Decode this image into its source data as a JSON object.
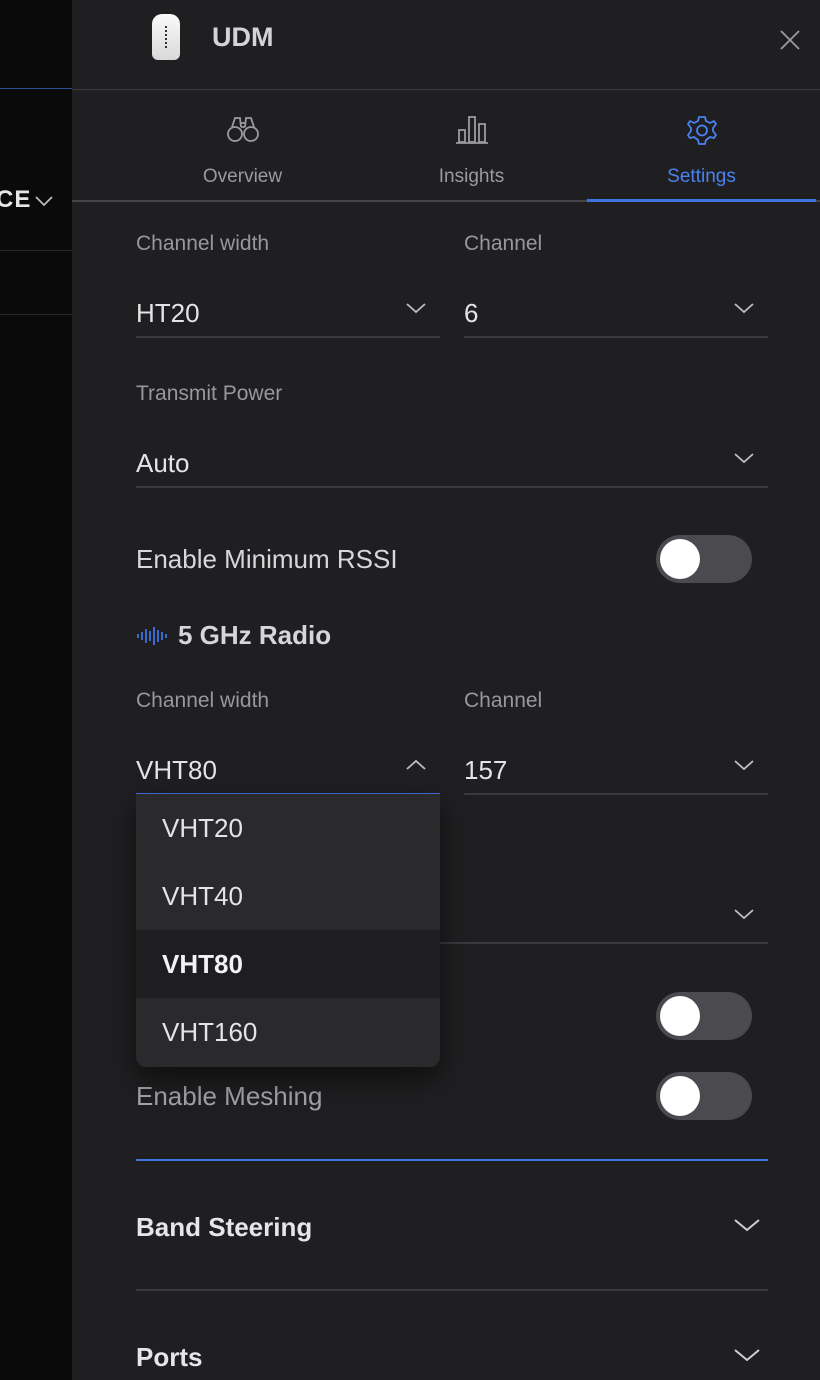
{
  "backdrop": {
    "partial_text": "CE"
  },
  "header": {
    "title": "UDM"
  },
  "tabs": [
    {
      "label": "Overview",
      "icon": "binoculars-icon"
    },
    {
      "label": "Insights",
      "icon": "bar-chart-icon"
    },
    {
      "label": "Settings",
      "icon": "gear-icon",
      "active": true
    }
  ],
  "radio_2g": {
    "channel_width_label": "Channel width",
    "channel_width_value": "HT20",
    "channel_label": "Channel",
    "channel_value": "6",
    "transmit_power_label": "Transmit Power",
    "transmit_power_value": "Auto",
    "min_rssi_label": "Enable Minimum RSSI",
    "min_rssi_enabled": false
  },
  "radio_5g": {
    "section_title": "5 GHz Radio",
    "channel_width_label": "Channel width",
    "channel_width_value": "VHT80",
    "channel_label": "Channel",
    "channel_value": "157",
    "width_options": [
      "VHT20",
      "VHT40",
      "VHT80",
      "VHT160"
    ],
    "selected_option": "VHT80",
    "min_rssi_enabled": false
  },
  "meshing": {
    "label": "Enable Meshing",
    "enabled": false
  },
  "accordions": [
    {
      "label": "Band Steering"
    },
    {
      "label": "Ports"
    }
  ],
  "colors": {
    "accent": "#3f73e0",
    "panel_bg": "#1f1f21",
    "dropdown_bg": "#2a2a2c"
  }
}
